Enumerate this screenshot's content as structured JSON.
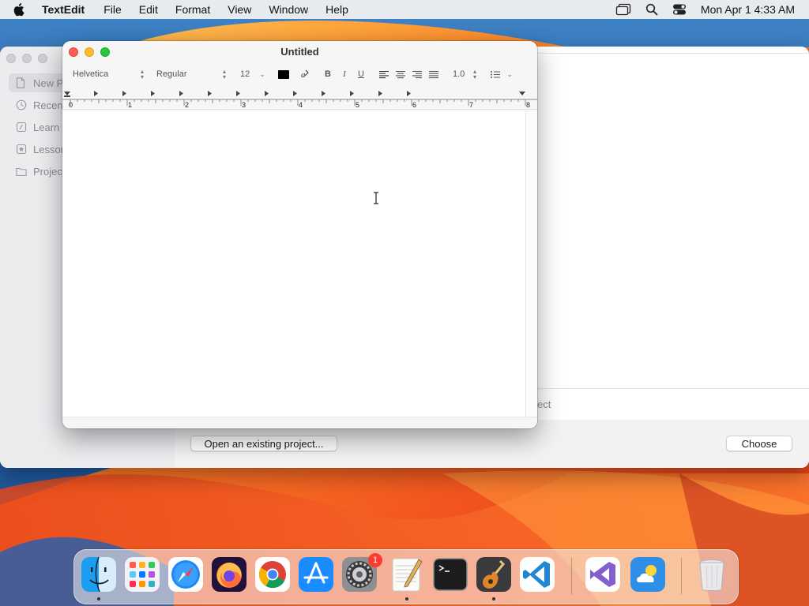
{
  "menubar": {
    "app_name": "TextEdit",
    "menus": [
      "File",
      "Edit",
      "Format",
      "View",
      "Window",
      "Help"
    ],
    "clock": "Mon Apr 1  4:33 AM"
  },
  "project_window": {
    "sidebar_items": [
      "New P",
      "Recen",
      "Learn",
      "Lessor",
      "Projec"
    ],
    "selected_index": 0,
    "partial_text": "ect",
    "open_button": "Open an existing project...",
    "choose_button": "Choose"
  },
  "document": {
    "title": "Untitled",
    "font_family": "Helvetica",
    "font_style": "Regular",
    "font_size": "12",
    "text_color": "#000000",
    "bold_label": "B",
    "italic_label": "I",
    "underline_label": "U",
    "line_spacing": "1.0",
    "ruler_numbers": [
      "0",
      "1",
      "2",
      "3",
      "4",
      "5",
      "6",
      "7",
      "8"
    ],
    "content": ""
  },
  "dock": {
    "apps": [
      {
        "name": "Finder",
        "icon": "finder-icon",
        "running": true
      },
      {
        "name": "Launchpad",
        "icon": "launchpad-icon",
        "running": false
      },
      {
        "name": "Safari",
        "icon": "safari-icon",
        "running": false
      },
      {
        "name": "Firefox",
        "icon": "firefox-icon",
        "running": false
      },
      {
        "name": "Chrome",
        "icon": "chrome-icon",
        "running": false
      },
      {
        "name": "App Store",
        "icon": "app-store-icon",
        "running": false
      },
      {
        "name": "System Settings",
        "icon": "system-settings-icon",
        "running": false,
        "badge": "1"
      },
      {
        "name": "TextEdit",
        "icon": "textedit-icon",
        "running": true
      },
      {
        "name": "Terminal",
        "icon": "terminal-icon",
        "running": false
      },
      {
        "name": "GarageBand",
        "icon": "garageband-icon",
        "running": true
      },
      {
        "name": "VS Code",
        "icon": "vscode-icon",
        "running": false
      },
      {
        "name": "Visual Studio",
        "icon": "visual-studio-icon",
        "running": false
      },
      {
        "name": "Weather",
        "icon": "weather-icon",
        "running": false
      },
      {
        "name": "Trash",
        "icon": "trash-icon",
        "running": false
      }
    ]
  },
  "colors": {
    "close": "#ff5f57",
    "minimize": "#febc2e",
    "zoom": "#28c840",
    "badge": "#ff3b30"
  }
}
